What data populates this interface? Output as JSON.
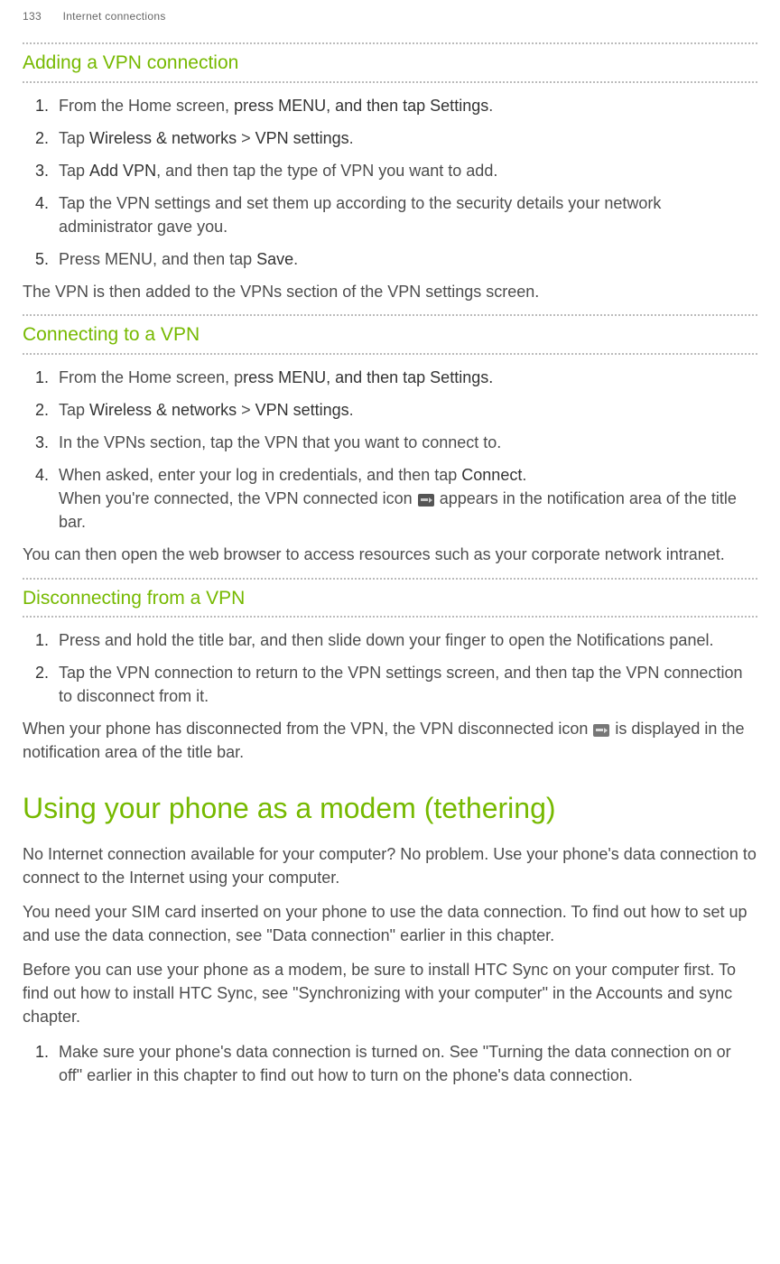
{
  "header": {
    "page_number": "133",
    "running_title": "Internet connections"
  },
  "sections": {
    "add_vpn": {
      "title": "Adding a VPN connection",
      "step1_a": "From the Home screen, ",
      "step1_b": "press MENU, and then tap Settings",
      "step1_c": ".",
      "step2_a": "Tap ",
      "step2_b": "Wireless & networks",
      "step2_c": " > ",
      "step2_d": "VPN settings",
      "step2_e": ".",
      "step3_a": "Tap ",
      "step3_b": "Add VPN",
      "step3_c": ", and then tap the type of VPN you want to add.",
      "step4": "Tap the VPN settings and set them up according to the security details your network administrator gave you.",
      "step5_a": "Press MENU, and then tap ",
      "step5_b": "Save",
      "step5_c": ".",
      "after": "The VPN is then added to the VPNs section of the VPN settings screen."
    },
    "connect_vpn": {
      "title": "Connecting to a VPN",
      "step1_a": "From the Home screen, p",
      "step1_b": "ress MENU, and then tap Settings.",
      "step2_a": "Tap ",
      "step2_b": "Wireless & networks",
      "step2_c": " > ",
      "step2_d": "VPN settings",
      "step2_e": ".",
      "step3": "In the VPNs section, tap the VPN that you want to connect to.",
      "step4_a": "When asked, enter your log in credentials, and then tap ",
      "step4_b": "Connect",
      "step4_c": ".",
      "step4_d": "When you're connected, the VPN connected icon ",
      "step4_e": " appears in the notification area of the title bar.",
      "after": "You can then open the web browser to access resources such as your corporate network intranet."
    },
    "disconnect_vpn": {
      "title": "Disconnecting from a VPN",
      "step1": "Press and hold the title bar, and then slide down your finger to open the Notifications panel.",
      "step2": "Tap the VPN connection to return to the VPN settings screen, and then tap the VPN connection to disconnect from it.",
      "after_a": "When your phone has disconnected from the VPN, the VPN disconnected icon ",
      "after_b": " is displayed in the notification area of the title bar."
    },
    "tethering": {
      "title": "Using your phone as a modem (tethering)",
      "p1": "No Internet connection available for your computer? No problem. Use your phone's data connection to connect to the Internet using your computer.",
      "p2": "You need your SIM card inserted on your phone to use the data connection. To find out how to set up and use the data connection, see \"Data connection\" earlier in this chapter.",
      "p3": "Before you can use your phone as a modem, be sure to install HTC Sync on your computer first. To find out how to install HTC Sync, see \"Synchronizing with your computer\" in the Accounts and sync chapter.",
      "step1": "Make sure your phone's data connection is turned on. See \"Turning the data connection on or off\" earlier in this chapter to find out how to turn on the phone's data connection."
    }
  }
}
